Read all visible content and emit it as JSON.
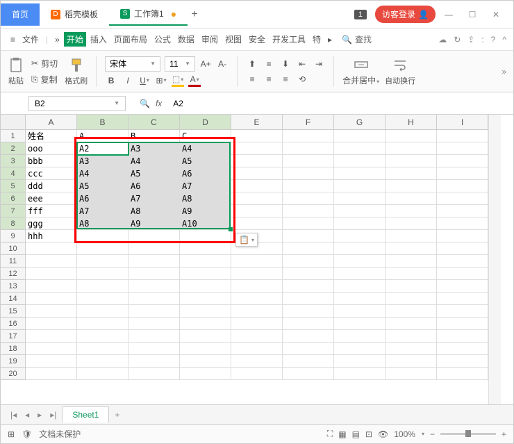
{
  "tabs": {
    "home": "首页",
    "docer": "稻壳模板",
    "workbook": "工作簿1"
  },
  "login": "访客登录",
  "badge": "1",
  "menu": {
    "file": "文件",
    "start": "开始",
    "insert": "插入",
    "layout": "页面布局",
    "formula": "公式",
    "data": "数据",
    "review": "审阅",
    "view": "视图",
    "security": "安全",
    "dev": "开发工具",
    "special": "特",
    "search": "查找"
  },
  "ribbon": {
    "paste": "粘贴",
    "cut": "剪切",
    "copy": "复制",
    "format_painter": "格式刷",
    "font": "宋体",
    "size": "11",
    "merge": "合并居中",
    "wrap": "自动换行"
  },
  "namebox": "B2",
  "formula": "A2",
  "cols": [
    "A",
    "B",
    "C",
    "D",
    "E",
    "F",
    "G",
    "H",
    "I"
  ],
  "rows": [
    {
      "n": 1,
      "cells": [
        "姓名",
        "A",
        "B",
        "C",
        "",
        "",
        "",
        "",
        ""
      ]
    },
    {
      "n": 2,
      "cells": [
        "ooo",
        "A2",
        "A3",
        "A4",
        "",
        "",
        "",
        "",
        ""
      ]
    },
    {
      "n": 3,
      "cells": [
        "bbb",
        "A3",
        "A4",
        "A5",
        "",
        "",
        "",
        "",
        ""
      ]
    },
    {
      "n": 4,
      "cells": [
        "ccc",
        "A4",
        "A5",
        "A6",
        "",
        "",
        "",
        "",
        ""
      ]
    },
    {
      "n": 5,
      "cells": [
        "ddd",
        "A5",
        "A6",
        "A7",
        "",
        "",
        "",
        "",
        ""
      ]
    },
    {
      "n": 6,
      "cells": [
        "eee",
        "A6",
        "A7",
        "A8",
        "",
        "",
        "",
        "",
        ""
      ]
    },
    {
      "n": 7,
      "cells": [
        "fff",
        "A7",
        "A8",
        "A9",
        "",
        "",
        "",
        "",
        ""
      ]
    },
    {
      "n": 8,
      "cells": [
        "ggg",
        "A8",
        "A9",
        "A10",
        "",
        "",
        "",
        "",
        ""
      ]
    },
    {
      "n": 9,
      "cells": [
        "hhh",
        "",
        "",
        "",
        "",
        "",
        "",
        "",
        ""
      ]
    },
    {
      "n": 10,
      "cells": [
        "",
        "",
        "",
        "",
        "",
        "",
        "",
        "",
        ""
      ]
    },
    {
      "n": 11,
      "cells": [
        "",
        "",
        "",
        "",
        "",
        "",
        "",
        "",
        ""
      ]
    },
    {
      "n": 12,
      "cells": [
        "",
        "",
        "",
        "",
        "",
        "",
        "",
        "",
        ""
      ]
    },
    {
      "n": 13,
      "cells": [
        "",
        "",
        "",
        "",
        "",
        "",
        "",
        "",
        ""
      ]
    },
    {
      "n": 14,
      "cells": [
        "",
        "",
        "",
        "",
        "",
        "",
        "",
        "",
        ""
      ]
    },
    {
      "n": 15,
      "cells": [
        "",
        "",
        "",
        "",
        "",
        "",
        "",
        "",
        ""
      ]
    },
    {
      "n": 16,
      "cells": [
        "",
        "",
        "",
        "",
        "",
        "",
        "",
        "",
        ""
      ]
    },
    {
      "n": 17,
      "cells": [
        "",
        "",
        "",
        "",
        "",
        "",
        "",
        "",
        ""
      ]
    },
    {
      "n": 18,
      "cells": [
        "",
        "",
        "",
        "",
        "",
        "",
        "",
        "",
        ""
      ]
    },
    {
      "n": 19,
      "cells": [
        "",
        "",
        "",
        "",
        "",
        "",
        "",
        "",
        ""
      ]
    },
    {
      "n": 20,
      "cells": [
        "",
        "",
        "",
        "",
        "",
        "",
        "",
        "",
        ""
      ]
    }
  ],
  "selection": {
    "startRow": 2,
    "endRow": 8,
    "startCol": 1,
    "endCol": 3,
    "activeRow": 2,
    "activeCol": 1
  },
  "sheet": "Sheet1",
  "status": "文档未保护",
  "zoom": "100%"
}
